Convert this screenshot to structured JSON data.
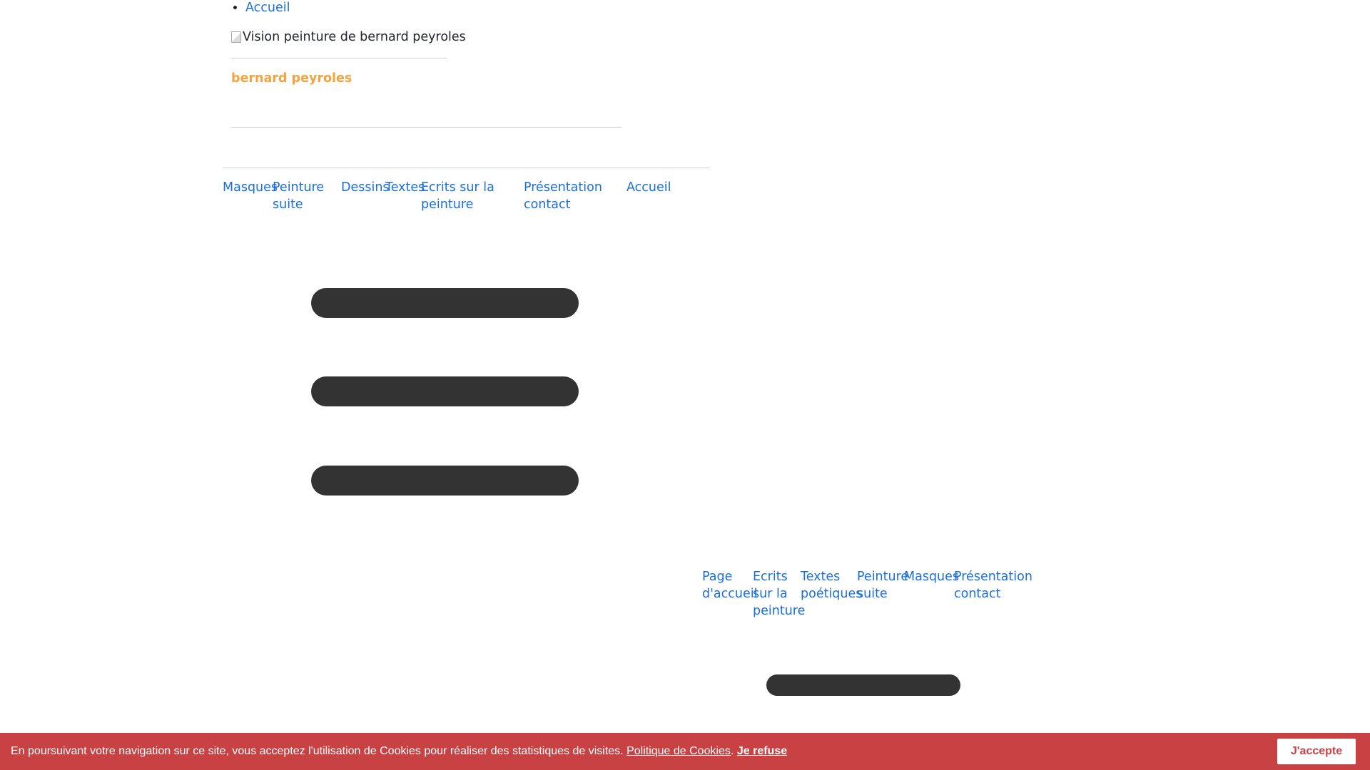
{
  "top_nav": {
    "home_link": "Accueil"
  },
  "header": {
    "logo_alt": "Vision peinture de bernard peyroles",
    "site_name": "bernard peyroles"
  },
  "main_menu": [
    "Masques",
    "Peinture suite",
    "Dessins",
    "Textes",
    "Ecrits sur la peinture",
    "Présentation contact",
    "Accueil"
  ],
  "footer_menu": [
    "Page d'accueil",
    "Ecrits sur la peinture",
    "Textes poétiques",
    "Peinture suite",
    "Masques",
    "Présentation contact"
  ],
  "cookie_banner": {
    "message": "En poursuivant votre navigation sur ce site, vous acceptez l'utilisation de Cookies pour réaliser des statistiques de visites.",
    "policy_link": "Politique de Cookies",
    "separator": ".",
    "refuse_link": "Je refuse",
    "accept_button": "J'accepte"
  },
  "colors": {
    "link": "#1a6fdc",
    "site_name": "#f4a340",
    "pill": "#333333",
    "cookie_bar": "#c84244"
  }
}
